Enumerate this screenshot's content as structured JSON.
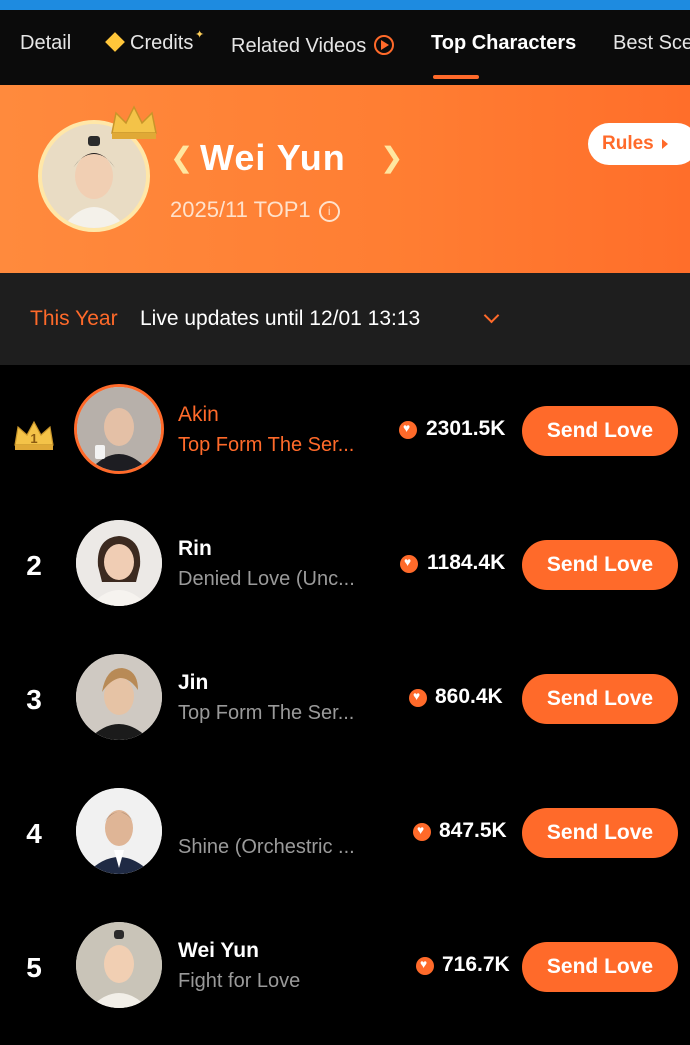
{
  "tabs": [
    {
      "label": "Detail"
    },
    {
      "label": "Credits"
    },
    {
      "label": "Related Videos"
    },
    {
      "label": "Top Characters"
    },
    {
      "label": "Best Sce"
    }
  ],
  "banner": {
    "name": "Wei Yun",
    "subtitle": "2025/11 TOP1",
    "rules_label": "Rules"
  },
  "period": {
    "label": "This Year",
    "text": "Live updates until 12/01 13:13"
  },
  "ranking": [
    {
      "rank": "1",
      "name": "Akin",
      "show": "Top Form The Ser...",
      "count": "2301.5K",
      "button": "Send Love"
    },
    {
      "rank": "2",
      "name": "Rin",
      "show": "Denied Love (Unc...",
      "count": "1184.4K",
      "button": "Send Love"
    },
    {
      "rank": "3",
      "name": "Jin",
      "show": "Top Form The Ser...",
      "count": "860.4K",
      "button": "Send Love"
    },
    {
      "rank": "4",
      "name": "",
      "show": "Shine (Orchestric ...",
      "count": "847.5K",
      "button": "Send Love"
    },
    {
      "rank": "5",
      "name": "Wei Yun",
      "show": "Fight for Love",
      "count": "716.7K",
      "button": "Send Love"
    }
  ],
  "colors": {
    "accent": "#ff6a2a",
    "banner": "#ff7d32",
    "background": "#000000"
  }
}
